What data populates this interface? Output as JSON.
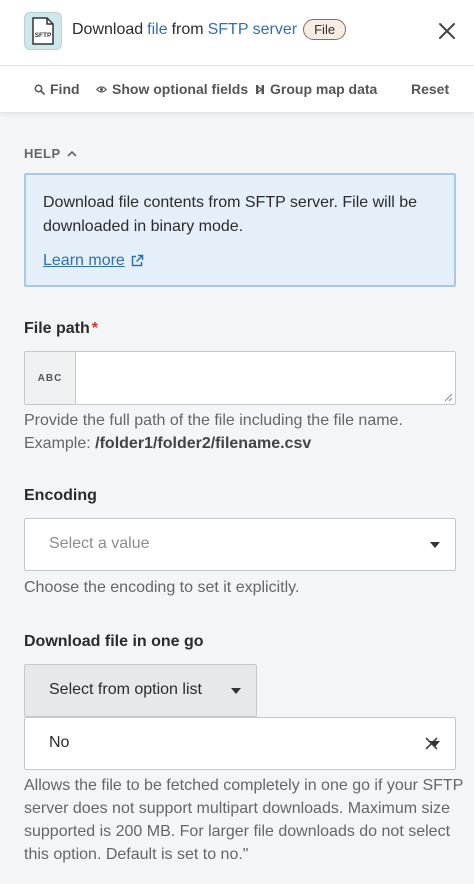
{
  "header": {
    "title_parts": [
      "Download",
      "file",
      "from",
      "SFTP server"
    ],
    "badge": "File",
    "icon_text": "SFTP"
  },
  "toolbar": {
    "find": "Find",
    "optional": "Show optional fields",
    "groupmap": "Group map data",
    "reset": "Reset"
  },
  "help": {
    "label": "HELP",
    "text": "Download file contents from SFTP server. File will be downloaded in binary mode.",
    "learn_more": "Learn more"
  },
  "file_path": {
    "label": "File path",
    "required_mark": "*",
    "type_tag": "ABC",
    "value": "",
    "hint": "Provide the full path of the file including the file name.",
    "example_prefix": "Example:",
    "example_value": "/folder1/folder2/filename.csv"
  },
  "encoding": {
    "label": "Encoding",
    "placeholder": "Select a value",
    "hint": "Choose the encoding to set it explicitly."
  },
  "download_one_go": {
    "label": "Download file in one go",
    "mode": "Select from option list",
    "value": "No",
    "hint": "Allows the file to be fetched completely in one go if your SFTP server does not support multipart downloads. Maximum size supported is 200 MB. For larger file downloads do not select this option. Default is set to no.\""
  },
  "colors": {
    "link": "#2f6fb0",
    "required": "#d0342c",
    "help_bg": "#e4eff9",
    "help_border": "#a9c9e8",
    "badge_bg": "#f6ece6"
  }
}
